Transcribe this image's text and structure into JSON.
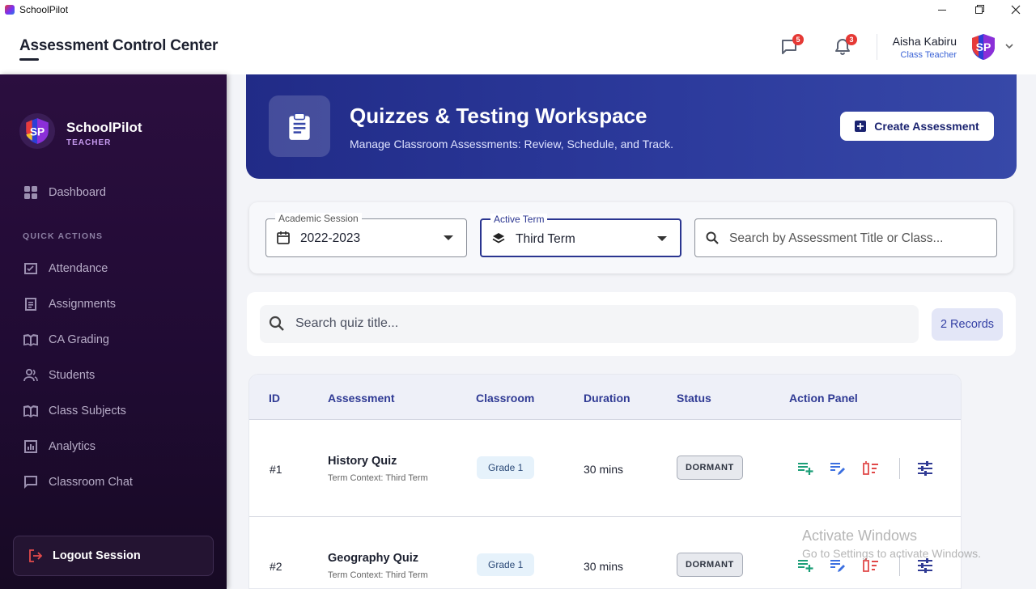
{
  "window": {
    "app_name": "SchoolPilot"
  },
  "header": {
    "title": "Assessment Control Center",
    "messages_badge": "5",
    "notifications_badge": "3",
    "user_name": "Aisha Kabiru",
    "user_role": "Class Teacher"
  },
  "sidebar": {
    "brand_name": "SchoolPilot",
    "brand_sub": "TEACHER",
    "dashboard": "Dashboard",
    "section_label": "QUICK ACTIONS",
    "items": [
      {
        "label": "Attendance",
        "icon": "attendance-icon"
      },
      {
        "label": "Assignments",
        "icon": "assignments-icon"
      },
      {
        "label": "CA Grading",
        "icon": "grading-icon"
      },
      {
        "label": "Students",
        "icon": "students-icon"
      },
      {
        "label": "Class Subjects",
        "icon": "subjects-icon"
      },
      {
        "label": "Analytics",
        "icon": "analytics-icon"
      },
      {
        "label": "Classroom Chat",
        "icon": "chat-icon"
      }
    ],
    "logout_label": "Logout Session"
  },
  "hero": {
    "title": "Quizzes & Testing Workspace",
    "subtitle": "Manage Classroom Assessments: Review, Schedule, and Track.",
    "create_label": "Create Assessment"
  },
  "filters": {
    "session_label": "Academic Session",
    "session_value": "2022-2023",
    "term_label": "Active Term",
    "term_value": "Third Term",
    "search_placeholder": "Search by Assessment Title or Class..."
  },
  "quiz_search": {
    "placeholder": "Search quiz title...",
    "records": "2 Records"
  },
  "table": {
    "headers": [
      "ID",
      "Assessment",
      "Classroom",
      "Duration",
      "Status",
      "Action Panel"
    ],
    "rows": [
      {
        "id": "#1",
        "title": "History Quiz",
        "context": "Term Context: Third Term",
        "classroom": "Grade 1",
        "duration": "30 mins",
        "status": "DORMANT"
      },
      {
        "id": "#2",
        "title": "Geography Quiz",
        "context": "Term Context: Third Term",
        "classroom": "Grade 1",
        "duration": "30 mins",
        "status": "DORMANT"
      }
    ]
  },
  "watermark": {
    "line1": "Activate Windows",
    "line2": "Go to Settings to activate Windows."
  },
  "colors": {
    "accent": "#2c3a9c",
    "sidebar": "#2b0e3f",
    "badge": "#e53935",
    "add": "#1b9e77",
    "edit": "#3b6fe0",
    "delete": "#e04848"
  }
}
